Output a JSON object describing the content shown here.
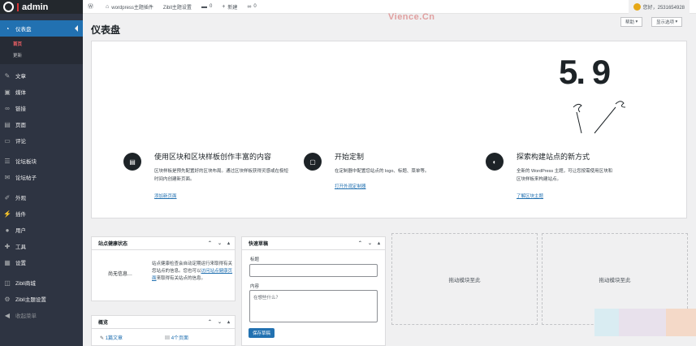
{
  "brand": {
    "title": "admin"
  },
  "sidebar": {
    "items": [
      {
        "label": "仪表盘",
        "icon": "dashboard-icon"
      },
      {
        "label": "文章",
        "icon": "pin-icon"
      },
      {
        "label": "媒体",
        "icon": "media-icon"
      },
      {
        "label": "链接",
        "icon": "link-icon"
      },
      {
        "label": "页面",
        "icon": "page-icon"
      },
      {
        "label": "评论",
        "icon": "comment-icon"
      },
      {
        "label": "论坛板块",
        "icon": "forum-icon"
      },
      {
        "label": "论坛帖子",
        "icon": "post-icon"
      },
      {
        "label": "外观",
        "icon": "brush-icon"
      },
      {
        "label": "插件",
        "icon": "plugin-icon"
      },
      {
        "label": "用户",
        "icon": "user-icon"
      },
      {
        "label": "工具",
        "icon": "wrench-icon"
      },
      {
        "label": "设置",
        "icon": "settings-icon"
      },
      {
        "label": "Zibll商城",
        "icon": "shop-icon"
      },
      {
        "label": "Zibll主题设置",
        "icon": "gear-icon"
      },
      {
        "label": "收起菜单",
        "icon": "collapse-icon"
      }
    ],
    "submenu": [
      "首页",
      "更新"
    ]
  },
  "topbar": {
    "site": "wordpress主题插件",
    "theme": "Zibll主题设置",
    "comments": "0",
    "new": "新建",
    "links": "0",
    "greeting": "您好，2531654928"
  },
  "watermark": "Vience.Cn",
  "page": {
    "title": "仪表盘",
    "help": "帮助",
    "screen_options": "显示选项"
  },
  "welcome": {
    "version": "5. 9",
    "cols": [
      {
        "title": "使用区块和区块样板创作丰富的内容",
        "desc": "区块样板是预先配置好的区块布局。通过区块样板获得灵感或在极短时间内创建新页面。",
        "link": "添加新页面"
      },
      {
        "title": "开始定制",
        "desc": "在定制器中配置您站点的 logo、标题、菜单等。",
        "link": "打开外观定制器"
      },
      {
        "title": "探索构建站点的新方式",
        "desc": "全新的 WordPress 主题，可让您按需使用区块和区块样板来构建站点。",
        "link": "了解区块主题"
      }
    ]
  },
  "site_health": {
    "title": "站点健康状态",
    "status": "尚无信息…",
    "text_before": "站点健康检查会自动定期运行来取得有关您站点的信息。您也可以",
    "link": "访问站点健康页面",
    "text_after": "来取得有关站点的信息。"
  },
  "quick_draft": {
    "title": "快速草稿",
    "title_label": "标题",
    "content_label": "内容",
    "content_placeholder": "在想些什么？",
    "save": "保存草稿"
  },
  "drop_zone": {
    "label": "拖动模块至此"
  },
  "glance": {
    "title": "概览",
    "posts": "1篇文章",
    "pages": "4个页面"
  }
}
